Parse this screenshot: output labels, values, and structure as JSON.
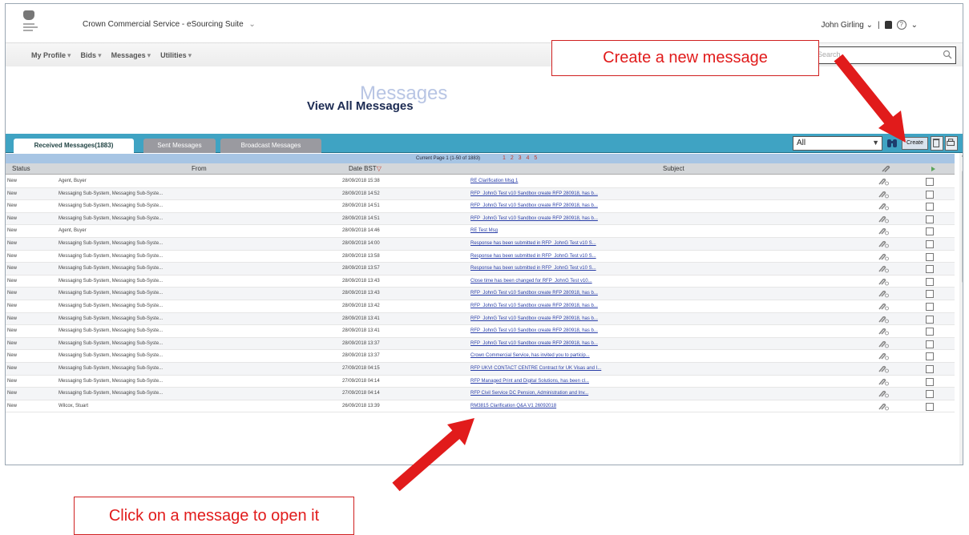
{
  "header": {
    "suite_title": "Crown Commercial Service - eSourcing Suite",
    "user_name": "John Girling",
    "help_glyph": "?"
  },
  "menu": [
    {
      "label": "My Profile"
    },
    {
      "label": "Bids"
    },
    {
      "label": "Messages"
    },
    {
      "label": "Utilities"
    }
  ],
  "search": {
    "placeholder": "Search"
  },
  "page": {
    "watermark": "Messages",
    "title": "View All Messages"
  },
  "tabs": [
    {
      "label": "Received Messages(1883)",
      "active": true
    },
    {
      "label": "Sent Messages",
      "active": false
    },
    {
      "label": "Broadcast Messages",
      "active": false
    }
  ],
  "toolbar": {
    "filter_value": "All",
    "create_label": "Create"
  },
  "pager": {
    "label": "Current Page 1 (1-50 of 1883)",
    "pages": "1 2 3 4 5"
  },
  "columns": {
    "status": "Status",
    "from": "From",
    "date": "Date BST",
    "subject": "Subject"
  },
  "rows": [
    {
      "status": "New",
      "from": "Agent, Buyer",
      "date": "28/09/2018 15:38",
      "subject": "RE Clarification Msg 1"
    },
    {
      "status": "New",
      "from": "Messaging Sub-System, Messaging Sub-Syste...",
      "date": "28/09/2018 14:52",
      "subject": "RFP_JohnG Test v10 Sandbox create RFP 280918, has b..."
    },
    {
      "status": "New",
      "from": "Messaging Sub-System, Messaging Sub-Syste...",
      "date": "28/09/2018 14:51",
      "subject": "RFP_JohnG Test v10 Sandbox create RFP 280918, has b..."
    },
    {
      "status": "New",
      "from": "Messaging Sub-System, Messaging Sub-Syste...",
      "date": "28/09/2018 14:51",
      "subject": "RFP_JohnG Test v10 Sandbox create RFP 280918, has b..."
    },
    {
      "status": "New",
      "from": "Agent, Buyer",
      "date": "28/09/2018 14:46",
      "subject": "RE Test Msg"
    },
    {
      "status": "New",
      "from": "Messaging Sub-System, Messaging Sub-Syste...",
      "date": "28/09/2018 14:00",
      "subject": "Response has been submitted in RFP_JohnG Test v10 S..."
    },
    {
      "status": "New",
      "from": "Messaging Sub-System, Messaging Sub-Syste...",
      "date": "28/09/2018 13:58",
      "subject": "Response has been submitted in RFP_JohnG Test v10 S..."
    },
    {
      "status": "New",
      "from": "Messaging Sub-System, Messaging Sub-Syste...",
      "date": "28/09/2018 13:57",
      "subject": "Response has been submitted in RFP_JohnG Test v10 S..."
    },
    {
      "status": "New",
      "from": "Messaging Sub-System, Messaging Sub-Syste...",
      "date": "28/09/2018 13:43",
      "subject": "Close time has been changed for RFP_JohnG Test v10..."
    },
    {
      "status": "New",
      "from": "Messaging Sub-System, Messaging Sub-Syste...",
      "date": "28/09/2018 13:43",
      "subject": "RFP_JohnG Test v10 Sandbox create RFP 280918, has b..."
    },
    {
      "status": "New",
      "from": "Messaging Sub-System, Messaging Sub-Syste...",
      "date": "28/09/2018 13:42",
      "subject": "RFP_JohnG Test v10 Sandbox create RFP 280918, has b..."
    },
    {
      "status": "New",
      "from": "Messaging Sub-System, Messaging Sub-Syste...",
      "date": "28/09/2018 13:41",
      "subject": "RFP_JohnG Test v10 Sandbox create RFP 280918, has b..."
    },
    {
      "status": "New",
      "from": "Messaging Sub-System, Messaging Sub-Syste...",
      "date": "28/09/2018 13:41",
      "subject": "RFP_JohnG Test v10 Sandbox create RFP 280918, has b..."
    },
    {
      "status": "New",
      "from": "Messaging Sub-System, Messaging Sub-Syste...",
      "date": "28/09/2018 13:37",
      "subject": "RFP_JohnG Test v10 Sandbox create RFP 280918, has b..."
    },
    {
      "status": "New",
      "from": "Messaging Sub-System, Messaging Sub-Syste...",
      "date": "28/09/2018 13:37",
      "subject": "Crown Commercial Service, has invited you to particip..."
    },
    {
      "status": "New",
      "from": "Messaging Sub-System, Messaging Sub-Syste...",
      "date": "27/09/2018 04:15",
      "subject": "RFP UKVI CONTACT CENTRE Contract for UK Visas and I..."
    },
    {
      "status": "New",
      "from": "Messaging Sub-System, Messaging Sub-Syste...",
      "date": "27/09/2018 04:14",
      "subject": "RFP Managed Print and Digital Solutions, has been cl..."
    },
    {
      "status": "New",
      "from": "Messaging Sub-System, Messaging Sub-Syste...",
      "date": "27/09/2018 04:14",
      "subject": "RFP Civil Service DC Pension, Administration and Inv..."
    },
    {
      "status": "New",
      "from": "Wilcox, Stuart",
      "date": "26/09/2018 13:39",
      "subject": "RM3815 Clarification Q&A V1 26092018"
    }
  ],
  "callouts": {
    "create": "Create a new message",
    "open": "Click on a message to open it"
  },
  "colors": {
    "tab_bar": "#3fa3c3",
    "callout": "#e11b1b",
    "link": "#2a3fa8"
  }
}
